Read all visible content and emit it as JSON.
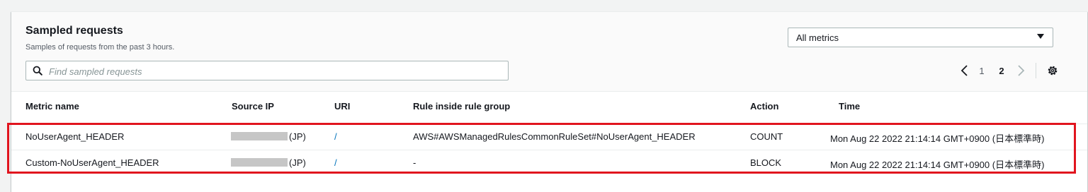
{
  "panel": {
    "title": "Sampled requests",
    "subtitle": "Samples of requests from the past 3 hours."
  },
  "metrics_select": {
    "value": "All metrics"
  },
  "search": {
    "placeholder": "Find sampled requests",
    "value": ""
  },
  "pagination": {
    "pages": [
      "1",
      "2"
    ],
    "current": "2"
  },
  "table": {
    "columns": [
      "Metric name",
      "Source IP",
      "URI",
      "Rule inside rule group",
      "Action",
      "Time"
    ],
    "rows": [
      {
        "metric_name": "NoUserAgent_HEADER",
        "source_ip_country": "(JP)",
        "uri": "/",
        "rule": "AWS#AWSManagedRulesCommonRuleSet#NoUserAgent_HEADER",
        "action": "COUNT",
        "time": "Mon Aug 22 2022 21:14:14 GMT+0900 (日本標準時)"
      },
      {
        "metric_name": "Custom-NoUserAgent_HEADER",
        "source_ip_country": "(JP)",
        "uri": "/",
        "rule": "-",
        "action": "BLOCK",
        "time": "Mon Aug 22 2022 21:14:14 GMT+0900 (日本標準時)"
      }
    ]
  },
  "colors": {
    "highlight": "#e1141e",
    "link": "#0073bb",
    "redaction": "#c6c6c6"
  },
  "icons": [
    "search-icon",
    "caret-down-icon",
    "chevron-left-icon",
    "chevron-right-icon",
    "gear-icon"
  ]
}
